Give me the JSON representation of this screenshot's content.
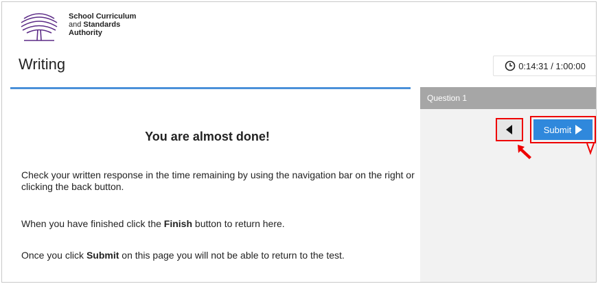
{
  "org": {
    "line1": "School Curriculum",
    "line2_prefix": "and ",
    "line2_bold": "Standards",
    "line3": "Authority"
  },
  "page_title": "Writing",
  "timer": {
    "elapsed": "0:14:31",
    "separator": " / ",
    "total": "1:00:00",
    "icon": "clock-icon"
  },
  "sidebar": {
    "question_label": "Question 1"
  },
  "nav": {
    "back_icon": "triangle-left-icon",
    "submit_label": "Submit",
    "submit_icon": "triangle-right-icon"
  },
  "content": {
    "heading": "You are almost done!",
    "p1": "Check your written response in the time remaining by using the navigation bar on the right or clicking the back button.",
    "p2_before": "When you have finished click the ",
    "p2_bold": "Finish",
    "p2_after": " button to return here.",
    "p3_before": "Once you click ",
    "p3_bold": "Submit",
    "p3_after": " on this page you will not be able to return to the test."
  },
  "annotations": {
    "highlight_color": "#ee0000",
    "accent_blue": "#4a90d9",
    "button_blue": "#2f88dc"
  }
}
